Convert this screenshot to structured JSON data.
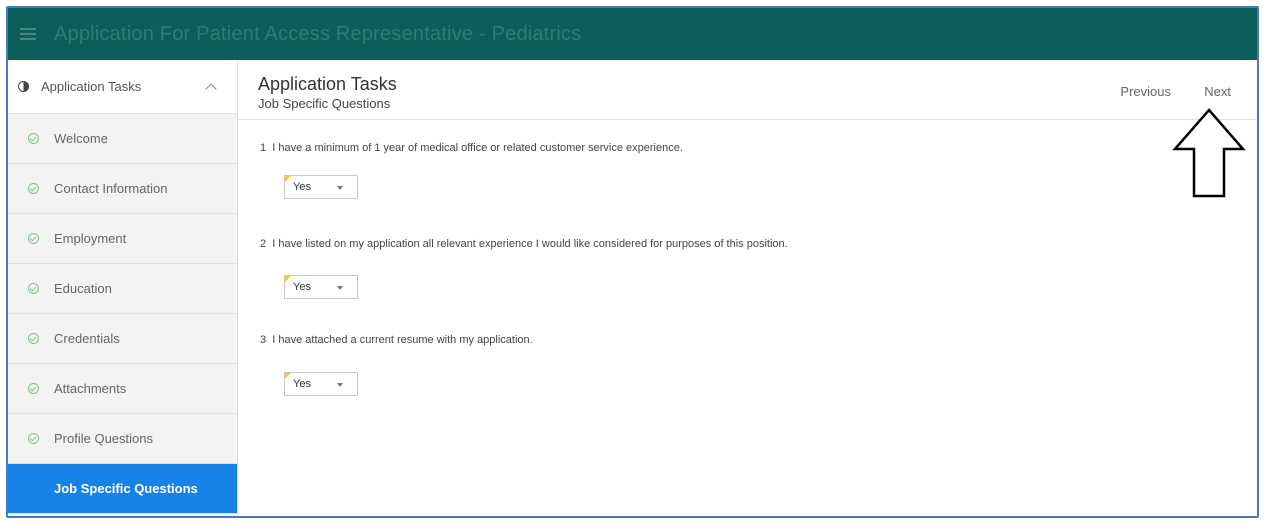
{
  "app": {
    "title": "Application For Patient Access Representative - Pediatrics",
    "colors": {
      "topbar": "#0b5e5a",
      "active_item": "#1783e8",
      "check": "#8bbf8b"
    }
  },
  "sidebar": {
    "header": "Application Tasks",
    "items": [
      {
        "label": "Welcome"
      },
      {
        "label": "Contact Information"
      },
      {
        "label": "Employment"
      },
      {
        "label": "Education"
      },
      {
        "label": "Credentials"
      },
      {
        "label": "Attachments"
      },
      {
        "label": "Profile Questions"
      },
      {
        "label": "Job Specific Questions"
      }
    ]
  },
  "main": {
    "title": "Application Tasks",
    "subtitle": "Job Specific Questions",
    "previous_label": "Previous",
    "next_label": "Next",
    "questions": [
      {
        "number": "1",
        "text": "I have a minimum of 1 year of medical office or related customer service experience.",
        "answer": "Yes"
      },
      {
        "number": "2",
        "text": "I have listed on my application all relevant experience I would like considered for purposes of this position.",
        "answer": "Yes"
      },
      {
        "number": "3",
        "text": "I have attached a current resume with my application.",
        "answer": "Yes"
      }
    ]
  }
}
